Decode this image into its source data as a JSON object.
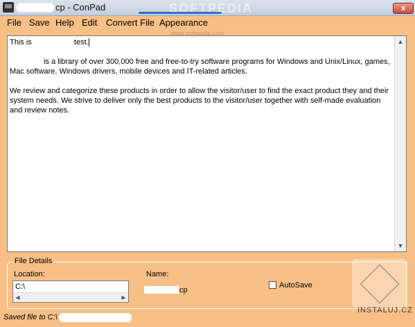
{
  "window": {
    "title": "cp - ConPad",
    "watermark": "SOFTPEDIA",
    "watermark_url": "www.softpedia.com",
    "close_glyph": "x"
  },
  "menu": {
    "items": [
      "File",
      "Save",
      "Help",
      "Edit",
      "Convert File",
      "Appearance"
    ]
  },
  "editor": {
    "line1_a": "This is",
    "line1_b": "test.",
    "para1": "is a library of over 300,000 free and free-to-try software programs for Windows and Unix/Linux, games, Mac software, Windows drivers, mobile devices and IT-related articles.",
    "para2": "We review and categorize these products in order to allow the visitor/user to find the exact product they and their system needs. We strive to deliver only the best products to the visitor/user together with self-made evaluation and review notes.",
    "scroll_up": "▲",
    "scroll_down": "▼"
  },
  "file_details": {
    "group_label": "File Details",
    "location_label": "Location:",
    "location_value": "C:\\",
    "name_label": "Name:",
    "name_value": "cp",
    "autosave_label": "AutoSave",
    "autosave_checked": false,
    "hscroll_left": "◀",
    "hscroll_right": "▶"
  },
  "logo": {
    "text": "INSTALUJ.CZ"
  },
  "status": {
    "text": "Saved file to C:\\"
  },
  "colors": {
    "window_bg": "#f8bf86",
    "close_button": "#c44b37",
    "progress": "#2f6fd0"
  }
}
